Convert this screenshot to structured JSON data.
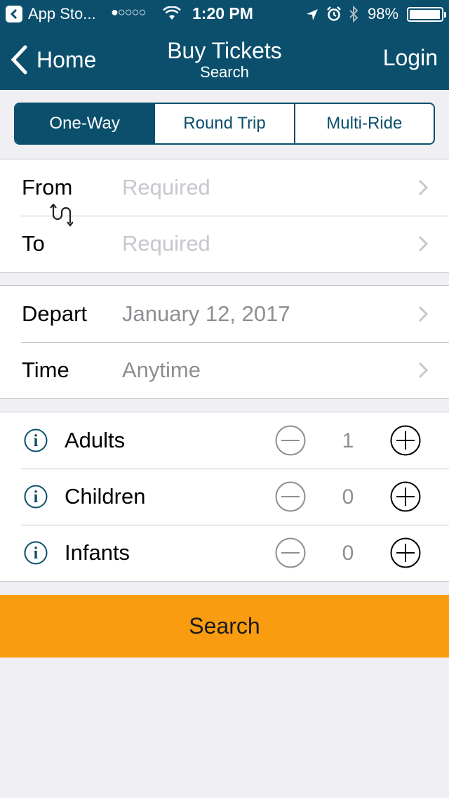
{
  "status_bar": {
    "back_app": "App Sto...",
    "signal": "●○○○○",
    "time": "1:20 PM",
    "battery_text": "98%",
    "battery_level": 0.98
  },
  "nav": {
    "back_label": "Home",
    "title": "Buy Tickets",
    "subtitle": "Search",
    "login_label": "Login"
  },
  "trip_types": [
    {
      "label": "One-Way",
      "active": true
    },
    {
      "label": "Round Trip",
      "active": false
    },
    {
      "label": "Multi-Ride",
      "active": false
    }
  ],
  "route": {
    "from_label": "From",
    "from_placeholder": "Required",
    "to_label": "To",
    "to_placeholder": "Required"
  },
  "schedule": {
    "depart_label": "Depart",
    "depart_value": "January 12, 2017",
    "time_label": "Time",
    "time_value": "Anytime"
  },
  "passengers": [
    {
      "label": "Adults",
      "count": "1"
    },
    {
      "label": "Children",
      "count": "0"
    },
    {
      "label": "Infants",
      "count": "0"
    }
  ],
  "search_label": "Search",
  "colors": {
    "brand": "#0b4f6c",
    "accent": "#f99c10",
    "background": "#efeff4"
  }
}
